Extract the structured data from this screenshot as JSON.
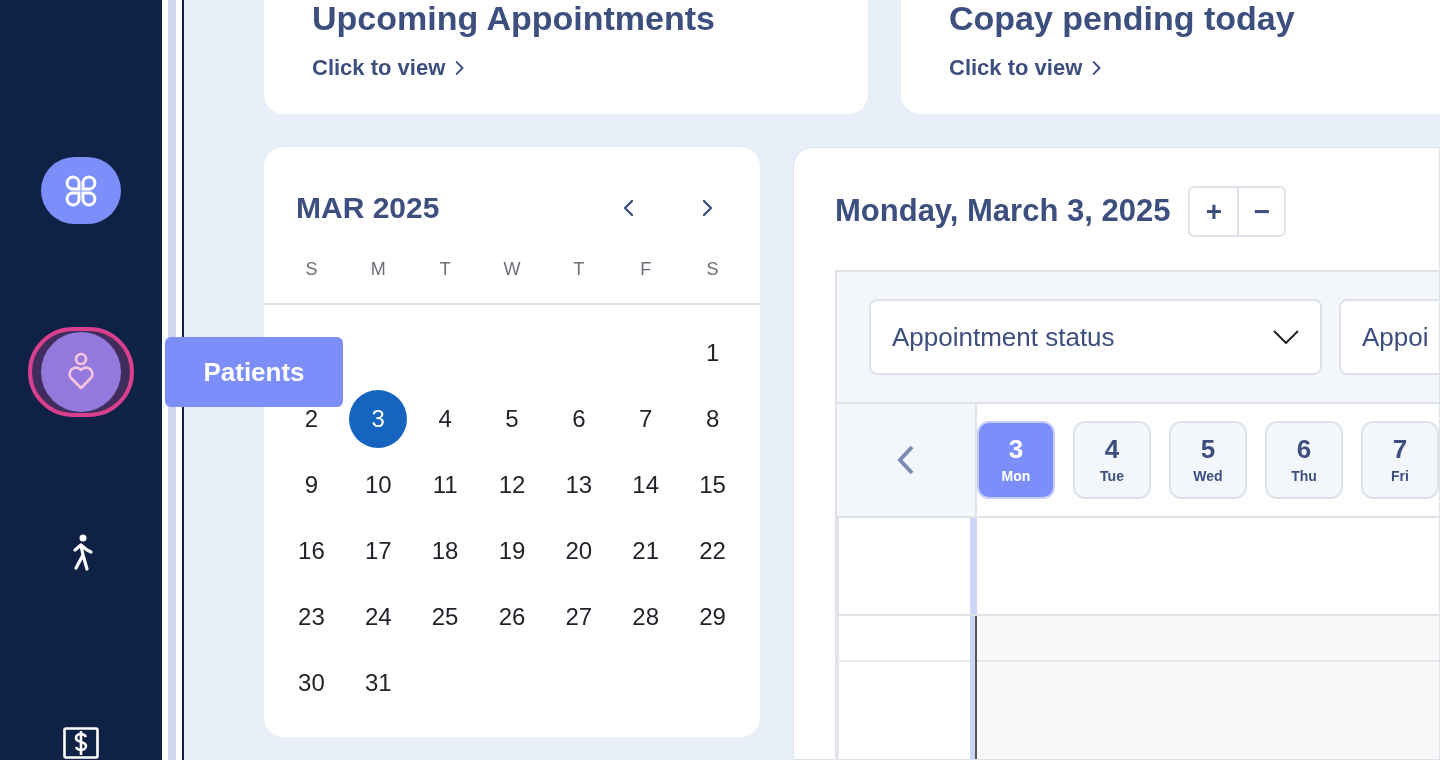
{
  "sidebar": {
    "items": [
      {
        "active": true,
        "selected": false
      },
      {
        "active": false,
        "selected": true,
        "tooltip": "Patients"
      },
      {
        "active": false,
        "selected": false
      },
      {
        "active": false,
        "selected": false
      }
    ]
  },
  "summary_cards": [
    {
      "title": "Upcoming Appointments",
      "link": "Click to view"
    },
    {
      "title": "Copay pending today",
      "link": "Click to view"
    }
  ],
  "mini_calendar": {
    "month": "MAR 2025",
    "weekdays": [
      "S",
      "M",
      "T",
      "W",
      "T",
      "F",
      "S"
    ],
    "weeks": [
      [
        {
          "label": "1",
          "selected": false
        }
      ],
      [
        {
          "label": "2",
          "selected": false
        },
        {
          "label": "3",
          "selected": true
        },
        {
          "label": "4",
          "selected": false
        },
        {
          "label": "5",
          "selected": false
        },
        {
          "label": "6",
          "selected": false
        },
        {
          "label": "7",
          "selected": false
        },
        {
          "label": "8",
          "selected": false
        }
      ],
      [
        {
          "label": "9",
          "selected": false
        },
        {
          "label": "10",
          "selected": false
        },
        {
          "label": "11",
          "selected": false
        },
        {
          "label": "12",
          "selected": false
        },
        {
          "label": "13",
          "selected": false
        },
        {
          "label": "14",
          "selected": false
        },
        {
          "label": "15",
          "selected": false
        }
      ],
      [
        {
          "label": "16",
          "selected": false
        },
        {
          "label": "17",
          "selected": false
        },
        {
          "label": "18",
          "selected": false
        },
        {
          "label": "19",
          "selected": false
        },
        {
          "label": "20",
          "selected": false
        },
        {
          "label": "21",
          "selected": false
        },
        {
          "label": "22",
          "selected": false
        }
      ],
      [
        {
          "label": "23",
          "selected": false
        },
        {
          "label": "24",
          "selected": false
        },
        {
          "label": "25",
          "selected": false
        },
        {
          "label": "26",
          "selected": false
        },
        {
          "label": "27",
          "selected": false
        },
        {
          "label": "28",
          "selected": false
        },
        {
          "label": "29",
          "selected": false
        }
      ],
      [
        {
          "label": "30",
          "selected": false
        },
        {
          "label": "31",
          "selected": false
        }
      ]
    ]
  },
  "schedule": {
    "title": "Monday, March 3, 2025",
    "zoom_buttons": [
      "+",
      "−"
    ],
    "filters": [
      {
        "label": "Appointment status"
      },
      {
        "label": "Appoi"
      }
    ],
    "days": [
      {
        "day": "3",
        "weekday": "Mon",
        "selected": true
      },
      {
        "day": "4",
        "weekday": "Tue",
        "selected": false
      },
      {
        "day": "5",
        "weekday": "Wed",
        "selected": false
      },
      {
        "day": "6",
        "weekday": "Thu",
        "selected": false
      },
      {
        "day": "7",
        "weekday": "Fri",
        "selected": false
      }
    ]
  }
}
